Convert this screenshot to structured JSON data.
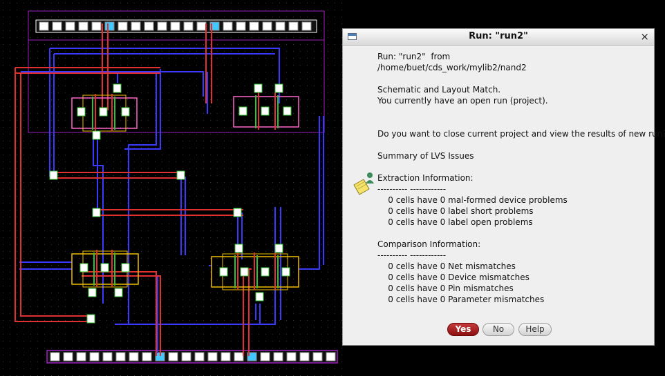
{
  "dialog": {
    "title": "Run: \"run2\"",
    "close_label": "×",
    "lines": [
      "Run: \"run2\"  from",
      "/home/buet/cds_work/mylib2/nand2",
      "",
      "Schematic and Layout Match.",
      "You currently have an open run (project).",
      "",
      "",
      "Do you want to close current project and view the results of new run?",
      "",
      "Summary of LVS Issues",
      "",
      "Extraction Information:",
      "---------- ------------",
      "    0 cells have 0 mal-formed device problems",
      "    0 cells have 0 label short problems",
      "    0 cells have 0 label open problems",
      "",
      "Comparison Information:",
      "---------- ------------",
      "    0 cells have 0 Net mismatches",
      "    0 cells have 0 Device mismatches",
      "    0 cells have 0 Pin mismatches",
      "    0 cells have 0 Parameter mismatches"
    ],
    "buttons": {
      "yes": "Yes",
      "no": "No",
      "help": "Help"
    },
    "icon": "note-icon"
  },
  "layout": {
    "icon": "layout-canvas",
    "colors": {
      "background": "#000000",
      "metal1": "#3a3aff",
      "poly": "#e03030",
      "nwell": "#a020c0",
      "pdiff": "#f0c000",
      "ndiff": "#ff66cc",
      "contact": "#ffffff",
      "via": "#40c8ff",
      "active": "#30c030"
    }
  }
}
